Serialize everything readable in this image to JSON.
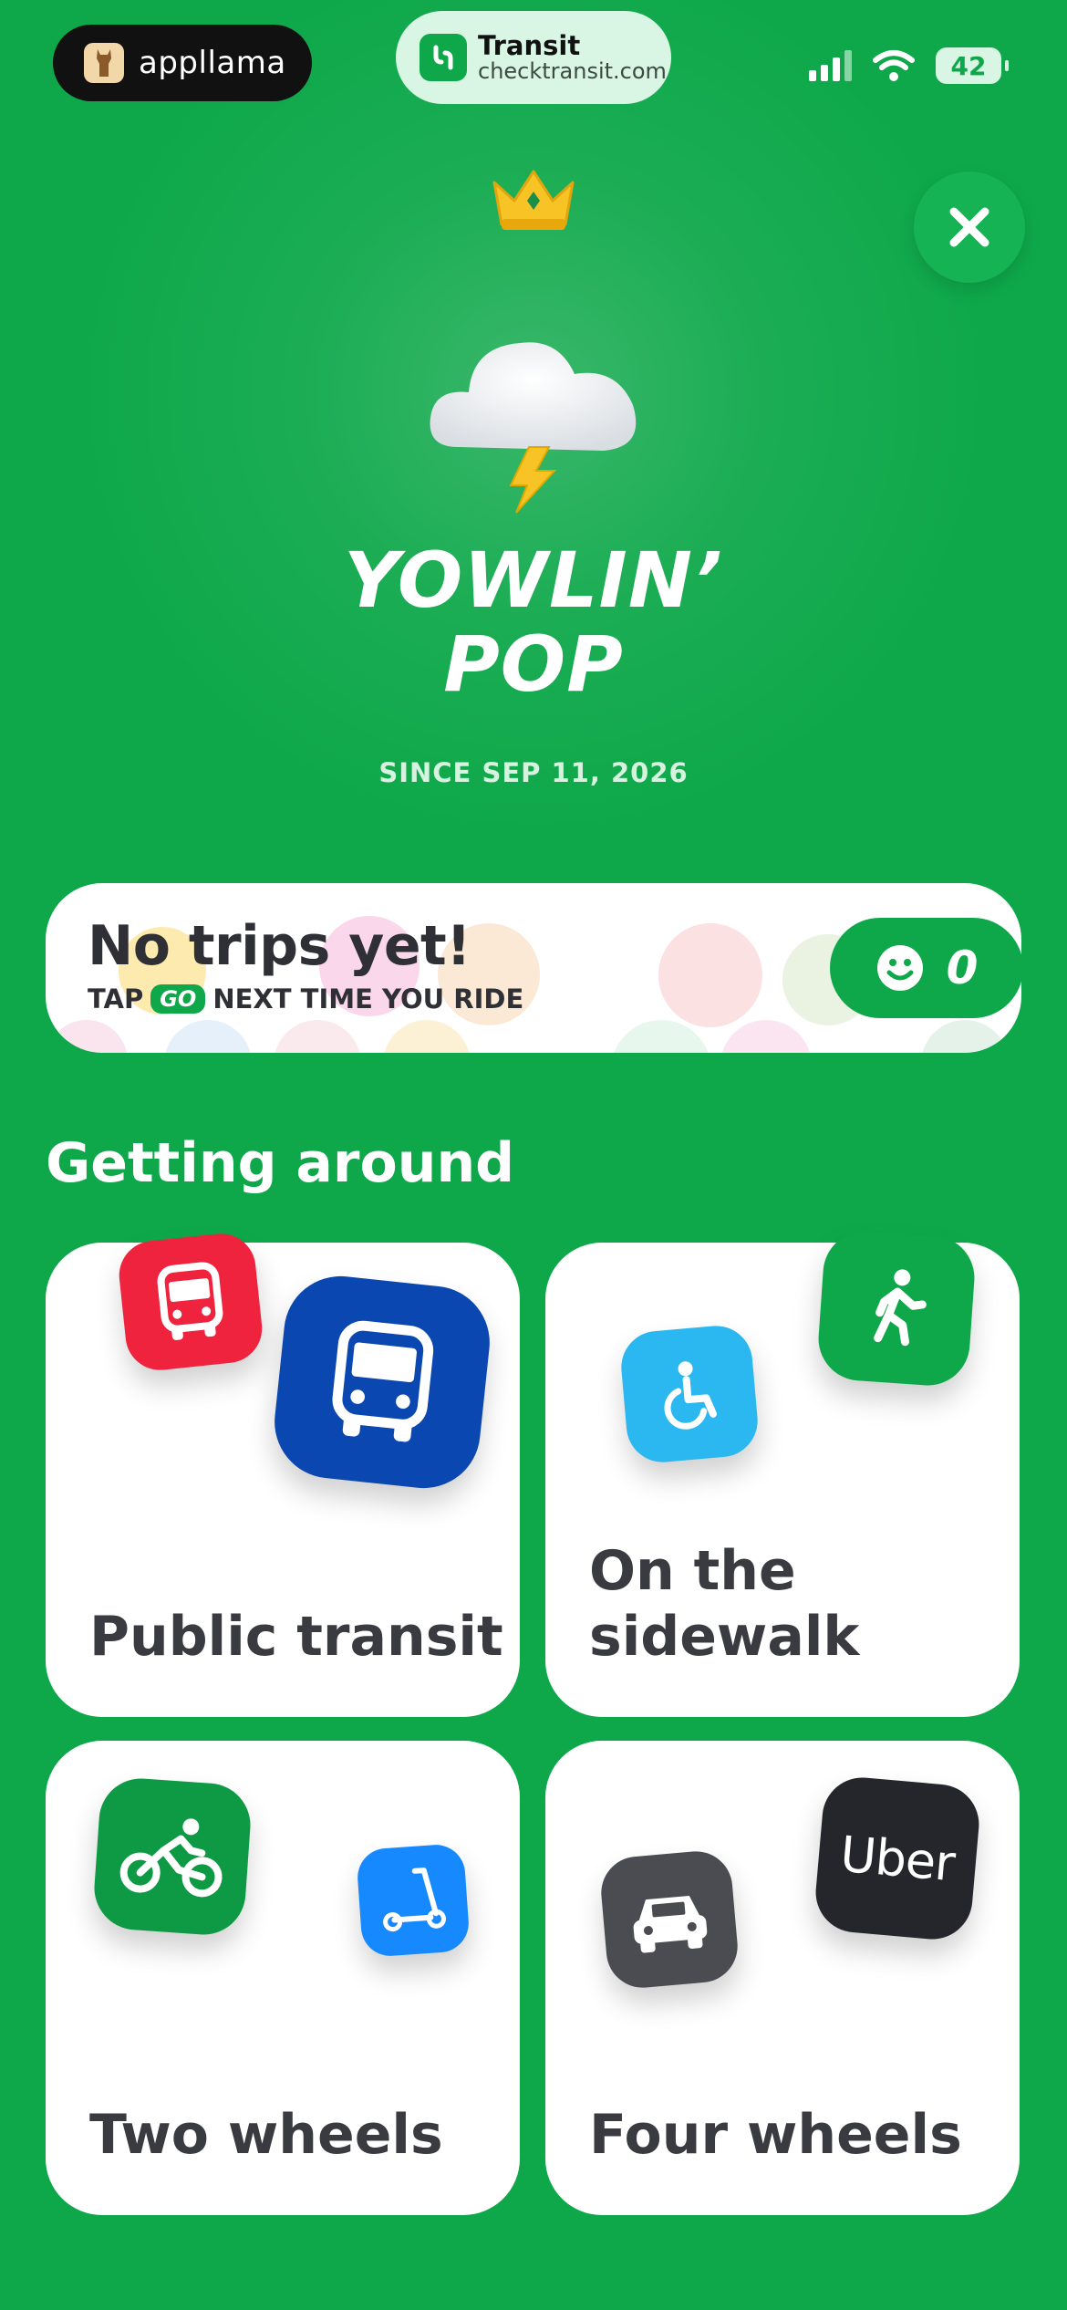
{
  "status_bar": {
    "appllama_label": "appllama",
    "app_name": "Transit",
    "app_url": "checktransit.com",
    "battery": "42"
  },
  "profile": {
    "title_line1": "YOWLIN’",
    "title_line2": "POP",
    "since": "SINCE SEP 11, 2026"
  },
  "trips": {
    "title": "No trips yet!",
    "sub_before": "TAP",
    "go_label": "GO",
    "sub_after": "NEXT TIME YOU RIDE",
    "count": "0"
  },
  "section_title": "Getting around",
  "tiles": [
    {
      "label": "Public transit"
    },
    {
      "label_line1": "On the",
      "label_line2": "sidewalk"
    },
    {
      "label": "Two wheels"
    },
    {
      "label": "Four wheels"
    }
  ],
  "uber_logo_text": "Uber",
  "colors": {
    "background": "#0ea84a",
    "bus_red": "#f0233f",
    "bus_blue": "#0b47b0",
    "accessibility_blue": "#2bb7ef",
    "walk_green": "#0ea84a",
    "bike_green": "#0e9a45",
    "scooter_blue": "#1689ff",
    "car_gray": "#4b4c51",
    "uber_black": "#25262b"
  }
}
